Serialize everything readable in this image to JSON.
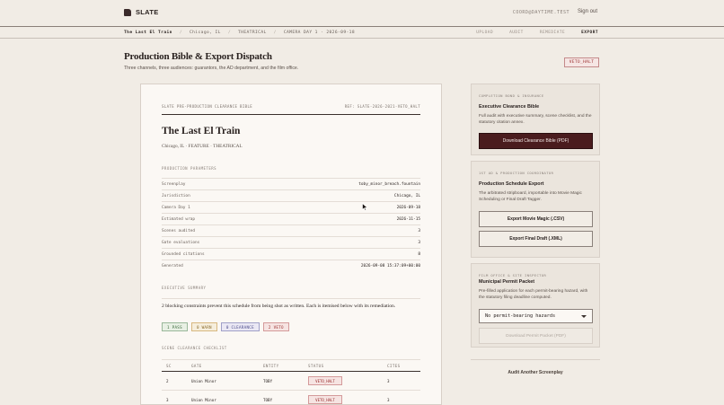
{
  "brand": {
    "name": "SLATE"
  },
  "nav": {
    "user_email": "COORD@DAYTIME.TEST",
    "signout": "Sign out"
  },
  "breadcrumb": {
    "title": "The Last El Train",
    "items": [
      "Chicago, IL",
      "THEATRICAL",
      "CAMERA DAY 1 · 2026-09-18"
    ]
  },
  "steps": [
    "UPLOAD",
    "AUDIT",
    "REMEDIATE",
    "EXPORT"
  ],
  "steps_active": "EXPORT",
  "page": {
    "title": "Production Bible & Export Dispatch",
    "subtitle": "Three channels, three audiences: guarantors, the AD department, and the film office.",
    "veto_badge": "VETO_HALT"
  },
  "document": {
    "header_left": "SLATE PRE-PRODUCTION CLEARANCE BIBLE",
    "header_right": "REF: SLATE-2026-2021-VETO_HALT",
    "title": "The Last El Train",
    "meta": "Chicago, IL · FEATURE · THEATRICAL",
    "params_label": "PRODUCTION PARAMETERS",
    "params": [
      {
        "key": "Screenplay",
        "value": "toby_minor_breach.fountain"
      },
      {
        "key": "Jurisdiction",
        "value": "Chicago, IL"
      },
      {
        "key": "Camera Day 1",
        "value": "2026-09-18"
      },
      {
        "key": "Estimated wrap",
        "value": "2026-11-15"
      },
      {
        "key": "Scenes audited",
        "value": "3"
      },
      {
        "key": "Gate evaluations",
        "value": "3"
      },
      {
        "key": "Grounded citations",
        "value": "8"
      },
      {
        "key": "Generated",
        "value": "2026-09-08 15:37:09+00:00"
      }
    ],
    "summary_label": "EXECUTIVE SUMMARY",
    "summary_text": "2 blocking constraints prevent this schedule from being shot as written. Each is itemised below with its remediation.",
    "chips": [
      {
        "label": "1 PASS",
        "kind": "pass"
      },
      {
        "label": "0 WARN",
        "kind": "warn"
      },
      {
        "label": "0 CLEARANCE",
        "kind": "clear"
      },
      {
        "label": "2 VETO",
        "kind": "veto"
      }
    ],
    "checklist_label": "SCENE CLEARANCE CHECKLIST",
    "checklist_headers": [
      "SC",
      "GATE",
      "ENTITY",
      "STATUS",
      "CITES"
    ],
    "checklist_rows": [
      {
        "sc": "2",
        "gate": "Union Minor",
        "entity": "TOBY",
        "status": "VETO_HALT",
        "cites": "3"
      },
      {
        "sc": "3",
        "gate": "Union Minor",
        "entity": "TOBY",
        "status": "VETO_HALT",
        "cites": "3"
      }
    ]
  },
  "panels": {
    "bible": {
      "label": "COMPLETION BOND & INSURANCE",
      "title": "Executive Clearance Bible",
      "desc": "Full audit with executive summary, scene checklist, and the statutory citation annex.",
      "button": "Download Clearance Bible (PDF)"
    },
    "schedule": {
      "label": "1ST AD & PRODUCTION COORDINATOR",
      "title": "Production Schedule Export",
      "desc": "The arbitrated stripboard, importable into Movie Magic Scheduling or Final Draft Tagger.",
      "button_mm": "Export Movie Magic (.CSV)",
      "button_fd": "Export Final Draft (.XML)"
    },
    "permit": {
      "label": "FILM OFFICE & SITE INSPECTOR",
      "title": "Municipal Permit Packet",
      "desc": "Pre-filled application for each permit-bearing hazard, with the statutory filing deadline computed.",
      "select_value": "No permit-bearing hazards",
      "button": "Download Permit Packet (PDF)"
    },
    "audit_link": "Audit Another Screenplay"
  }
}
